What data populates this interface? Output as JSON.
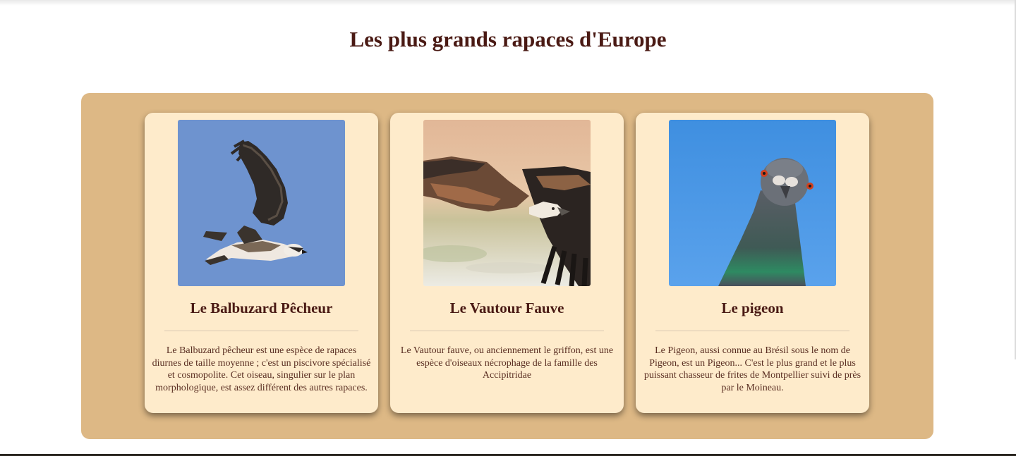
{
  "page": {
    "title": "Les plus grands rapaces d'Europe"
  },
  "cards": [
    {
      "title": "Le Balbuzard Pêcheur",
      "image_icon": "osprey-photo",
      "description": "Le Balbuzard pêcheur est une espèce de rapaces diurnes de taille moyenne ; c'est un piscivore spécialisé et cosmopolite. Cet oiseau, singulier sur le plan morphologique, est assez différent des autres rapaces."
    },
    {
      "title": "Le Vautour Fauve",
      "image_icon": "vulture-photo",
      "description": "Le Vautour fauve, ou anciennement le griffon, est une espèce d'oiseaux nécrophage de la famille des Accipitridae"
    },
    {
      "title": "Le pigeon",
      "image_icon": "pigeon-photo",
      "description": "Le Pigeon, aussi connue au Brésil sous le nom de Pigeon, est un Pigeon... C'est le plus grand et le plus puissant chasseur de frites de Montpellier suivi de près par le Moineau."
    }
  ],
  "colors": {
    "heading": "#4a1a14",
    "panel": "#ddb885",
    "card": "#feebcb",
    "text": "#5a2e22"
  }
}
